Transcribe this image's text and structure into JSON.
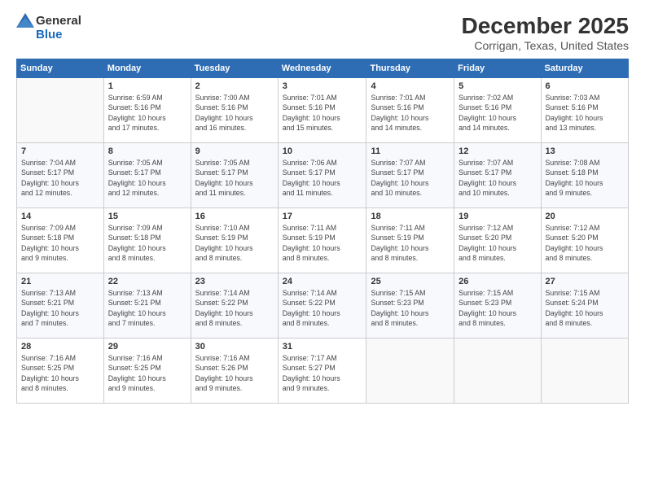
{
  "header": {
    "logo_general": "General",
    "logo_blue": "Blue",
    "month_title": "December 2025",
    "location": "Corrigan, Texas, United States"
  },
  "days_of_week": [
    "Sunday",
    "Monday",
    "Tuesday",
    "Wednesday",
    "Thursday",
    "Friday",
    "Saturday"
  ],
  "weeks": [
    [
      {
        "day": "",
        "info": ""
      },
      {
        "day": "1",
        "info": "Sunrise: 6:59 AM\nSunset: 5:16 PM\nDaylight: 10 hours\nand 17 minutes."
      },
      {
        "day": "2",
        "info": "Sunrise: 7:00 AM\nSunset: 5:16 PM\nDaylight: 10 hours\nand 16 minutes."
      },
      {
        "day": "3",
        "info": "Sunrise: 7:01 AM\nSunset: 5:16 PM\nDaylight: 10 hours\nand 15 minutes."
      },
      {
        "day": "4",
        "info": "Sunrise: 7:01 AM\nSunset: 5:16 PM\nDaylight: 10 hours\nand 14 minutes."
      },
      {
        "day": "5",
        "info": "Sunrise: 7:02 AM\nSunset: 5:16 PM\nDaylight: 10 hours\nand 14 minutes."
      },
      {
        "day": "6",
        "info": "Sunrise: 7:03 AM\nSunset: 5:16 PM\nDaylight: 10 hours\nand 13 minutes."
      }
    ],
    [
      {
        "day": "7",
        "info": "Sunrise: 7:04 AM\nSunset: 5:17 PM\nDaylight: 10 hours\nand 12 minutes."
      },
      {
        "day": "8",
        "info": "Sunrise: 7:05 AM\nSunset: 5:17 PM\nDaylight: 10 hours\nand 12 minutes."
      },
      {
        "day": "9",
        "info": "Sunrise: 7:05 AM\nSunset: 5:17 PM\nDaylight: 10 hours\nand 11 minutes."
      },
      {
        "day": "10",
        "info": "Sunrise: 7:06 AM\nSunset: 5:17 PM\nDaylight: 10 hours\nand 11 minutes."
      },
      {
        "day": "11",
        "info": "Sunrise: 7:07 AM\nSunset: 5:17 PM\nDaylight: 10 hours\nand 10 minutes."
      },
      {
        "day": "12",
        "info": "Sunrise: 7:07 AM\nSunset: 5:17 PM\nDaylight: 10 hours\nand 10 minutes."
      },
      {
        "day": "13",
        "info": "Sunrise: 7:08 AM\nSunset: 5:18 PM\nDaylight: 10 hours\nand 9 minutes."
      }
    ],
    [
      {
        "day": "14",
        "info": "Sunrise: 7:09 AM\nSunset: 5:18 PM\nDaylight: 10 hours\nand 9 minutes."
      },
      {
        "day": "15",
        "info": "Sunrise: 7:09 AM\nSunset: 5:18 PM\nDaylight: 10 hours\nand 8 minutes."
      },
      {
        "day": "16",
        "info": "Sunrise: 7:10 AM\nSunset: 5:19 PM\nDaylight: 10 hours\nand 8 minutes."
      },
      {
        "day": "17",
        "info": "Sunrise: 7:11 AM\nSunset: 5:19 PM\nDaylight: 10 hours\nand 8 minutes."
      },
      {
        "day": "18",
        "info": "Sunrise: 7:11 AM\nSunset: 5:19 PM\nDaylight: 10 hours\nand 8 minutes."
      },
      {
        "day": "19",
        "info": "Sunrise: 7:12 AM\nSunset: 5:20 PM\nDaylight: 10 hours\nand 8 minutes."
      },
      {
        "day": "20",
        "info": "Sunrise: 7:12 AM\nSunset: 5:20 PM\nDaylight: 10 hours\nand 8 minutes."
      }
    ],
    [
      {
        "day": "21",
        "info": "Sunrise: 7:13 AM\nSunset: 5:21 PM\nDaylight: 10 hours\nand 7 minutes."
      },
      {
        "day": "22",
        "info": "Sunrise: 7:13 AM\nSunset: 5:21 PM\nDaylight: 10 hours\nand 7 minutes."
      },
      {
        "day": "23",
        "info": "Sunrise: 7:14 AM\nSunset: 5:22 PM\nDaylight: 10 hours\nand 8 minutes."
      },
      {
        "day": "24",
        "info": "Sunrise: 7:14 AM\nSunset: 5:22 PM\nDaylight: 10 hours\nand 8 minutes."
      },
      {
        "day": "25",
        "info": "Sunrise: 7:15 AM\nSunset: 5:23 PM\nDaylight: 10 hours\nand 8 minutes."
      },
      {
        "day": "26",
        "info": "Sunrise: 7:15 AM\nSunset: 5:23 PM\nDaylight: 10 hours\nand 8 minutes."
      },
      {
        "day": "27",
        "info": "Sunrise: 7:15 AM\nSunset: 5:24 PM\nDaylight: 10 hours\nand 8 minutes."
      }
    ],
    [
      {
        "day": "28",
        "info": "Sunrise: 7:16 AM\nSunset: 5:25 PM\nDaylight: 10 hours\nand 8 minutes."
      },
      {
        "day": "29",
        "info": "Sunrise: 7:16 AM\nSunset: 5:25 PM\nDaylight: 10 hours\nand 9 minutes."
      },
      {
        "day": "30",
        "info": "Sunrise: 7:16 AM\nSunset: 5:26 PM\nDaylight: 10 hours\nand 9 minutes."
      },
      {
        "day": "31",
        "info": "Sunrise: 7:17 AM\nSunset: 5:27 PM\nDaylight: 10 hours\nand 9 minutes."
      },
      {
        "day": "",
        "info": ""
      },
      {
        "day": "",
        "info": ""
      },
      {
        "day": "",
        "info": ""
      }
    ]
  ]
}
